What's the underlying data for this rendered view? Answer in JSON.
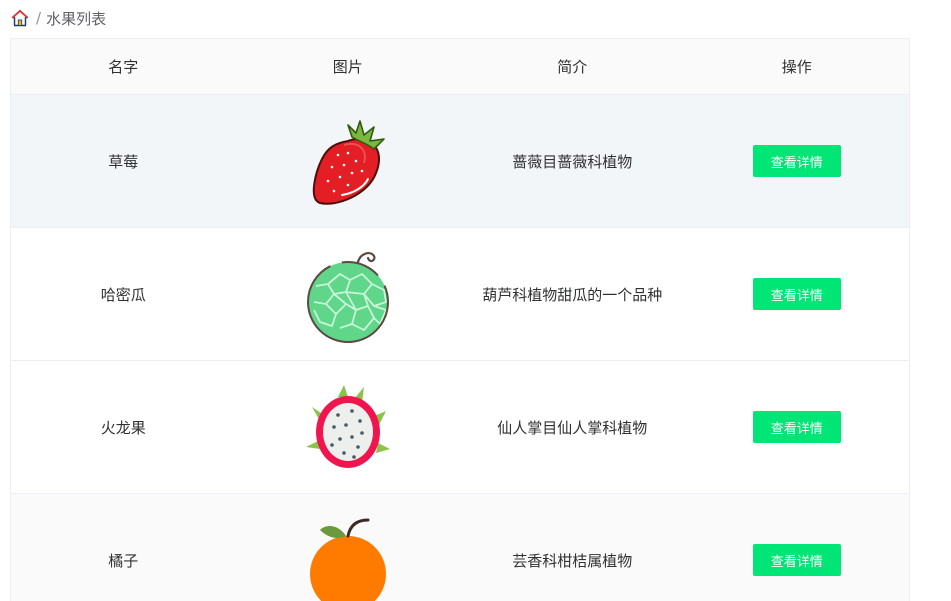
{
  "breadcrumb": {
    "icon": "home-icon",
    "current": "水果列表"
  },
  "table": {
    "headers": [
      "名字",
      "图片",
      "简介",
      "操作"
    ],
    "rows": [
      {
        "name": "草莓",
        "image_icon": "strawberry-icon",
        "intro": "蔷薇目蔷薇科植物",
        "action": "查看详情"
      },
      {
        "name": "哈密瓜",
        "image_icon": "cantaloupe-icon",
        "intro": "葫芦科植物甜瓜的一个品种",
        "action": "查看详情"
      },
      {
        "name": "火龙果",
        "image_icon": "dragonfruit-icon",
        "intro": "仙人掌目仙人掌科植物",
        "action": "查看详情"
      },
      {
        "name": "橘子",
        "image_icon": "orange-icon",
        "intro": "芸香科柑桔属植物",
        "action": "查看详情"
      }
    ]
  },
  "colors": {
    "button": "#00e676",
    "header_bg": "#fafafa",
    "highlight_row": "#f3f6f9"
  }
}
